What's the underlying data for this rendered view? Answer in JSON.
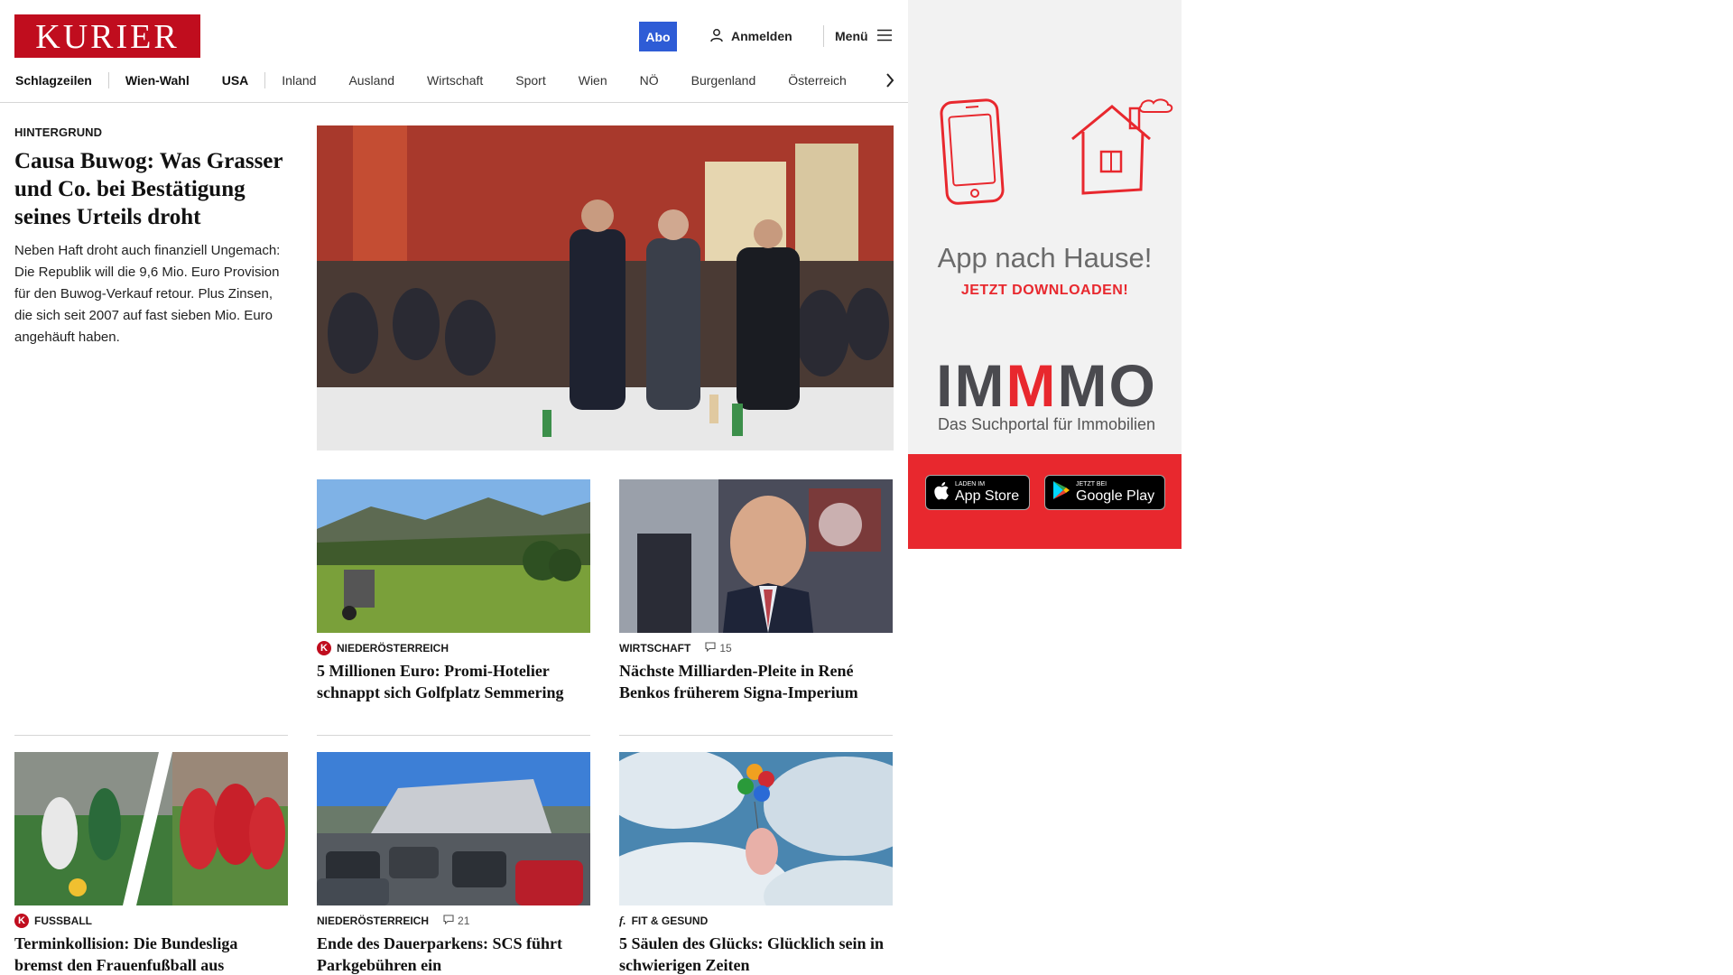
{
  "header": {
    "logo": "KURIER",
    "abo_label": "Abo",
    "login_label": "Anmelden",
    "menu_label": "Menü"
  },
  "nav": {
    "items": [
      {
        "label": "Schlagzeilen",
        "bold": true
      },
      {
        "label": "Wien-Wahl",
        "bold": true
      },
      {
        "label": "USA",
        "bold": true
      },
      {
        "label": "Inland",
        "bold": false
      },
      {
        "label": "Ausland",
        "bold": false
      },
      {
        "label": "Wirtschaft",
        "bold": false
      },
      {
        "label": "Sport",
        "bold": false
      },
      {
        "label": "Wien",
        "bold": false
      },
      {
        "label": "NÖ",
        "bold": false
      },
      {
        "label": "Burgenland",
        "bold": false
      },
      {
        "label": "Österreich",
        "bold": false
      }
    ]
  },
  "lead": {
    "kicker": "Hintergrund",
    "title": "Causa Buwog: Was Grasser und Co. bei Bestätigung seines Urteils droht",
    "text": "Neben Haft droht auch finanziell Ungemach: Die Republik will die 9,6 Mio. Euro Provision für den Buwog-Verkauf retour. Plus Zinsen, die sich seit 2007 auf fast sieben Mio. Euro angehäuft haben."
  },
  "cards": [
    {
      "category": "Niederösterreich",
      "badge": "K",
      "comments": "",
      "title": "5 Millionen Euro: Promi-Hotelier schnappt sich Golfplatz Semmering"
    },
    {
      "category": "Wirtschaft",
      "badge": "",
      "comments": "15",
      "title": "Nächste Milliarden-Pleite in René Benkos früherem Signa-Imperium"
    },
    {
      "category": "Fussball",
      "badge": "K",
      "comments": "",
      "title": "Terminkollision: Die Bundesliga bremst den Frauenfußball aus"
    },
    {
      "category": "Niederösterreich",
      "badge": "",
      "comments": "21",
      "title": "Ende des Dauerparkens: SCS führt Parkgebühren ein"
    },
    {
      "category": "Fit & Gesund",
      "badge": "f.",
      "comments": "",
      "title": "5 Säulen des Glücks: Glücklich sein in schwierigen Zeiten"
    }
  ],
  "ad": {
    "headline": "App nach Hause!",
    "subline": "JETZT DOWNLOADEN!",
    "brand_part1": "IM",
    "brand_part2": "M",
    "brand_part3": "MO",
    "tagline": "Das Suchportal für Immobilien",
    "appstore_small": "Laden im",
    "appstore_big": "App Store",
    "googleplay_small": "JETZT BEI",
    "googleplay_big": "Google Play"
  },
  "colors": {
    "brand_red": "#c00d1e",
    "abo_blue": "#2e5cd6",
    "ad_red": "#e8282e"
  }
}
